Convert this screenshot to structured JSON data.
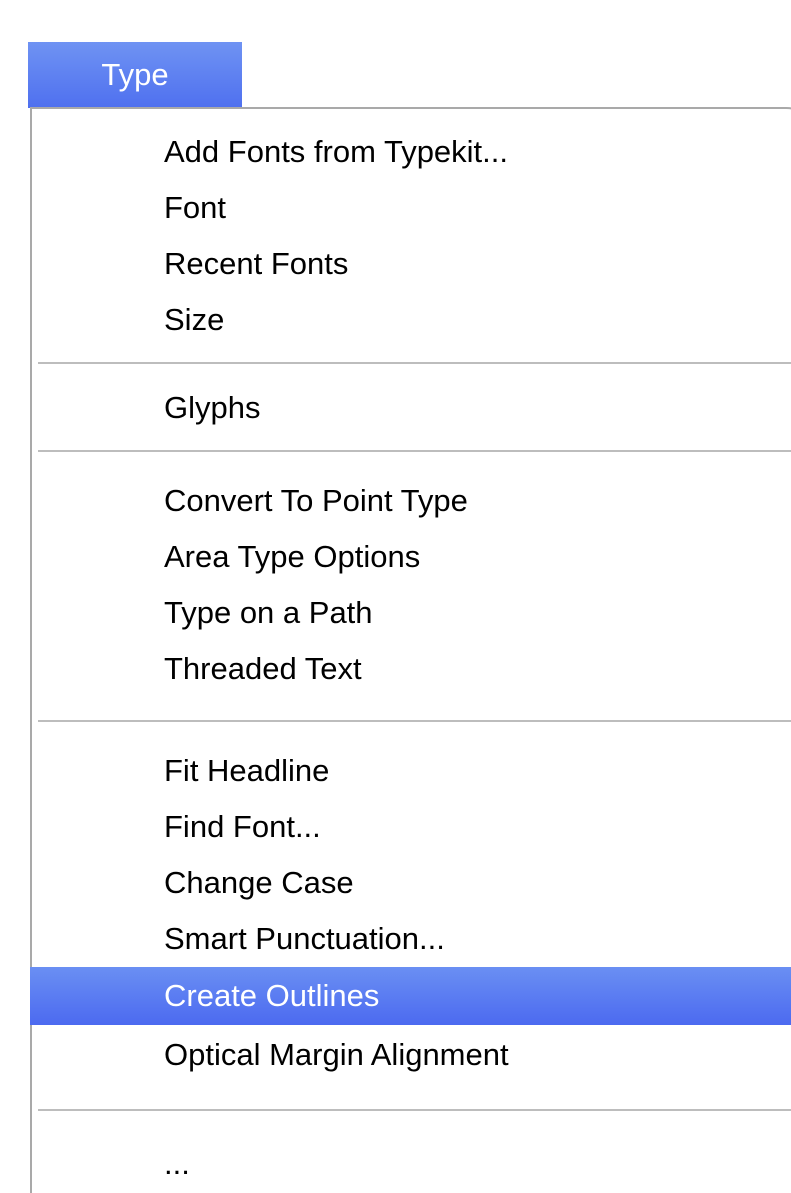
{
  "menubar": {
    "title": "Type"
  },
  "menu": {
    "groups": [
      [
        "Add Fonts from Typekit...",
        "Font",
        "Recent Fonts",
        "Size"
      ],
      [
        "Glyphs"
      ],
      [
        "Convert To Point Type",
        "Area Type Options",
        "Type on a Path",
        "Threaded Text"
      ],
      [
        "Fit Headline",
        "Find Font...",
        "Change Case",
        "Smart Punctuation...",
        "Create Outlines",
        "Optical Margin Alignment"
      ],
      [
        "..."
      ]
    ],
    "highlighted_item": "Create Outlines"
  },
  "colors": {
    "highlight_top": "#6a8ff3",
    "highlight_bottom": "#4c6af0",
    "border": "#a9a9a9",
    "separator": "#bdbdbd"
  }
}
